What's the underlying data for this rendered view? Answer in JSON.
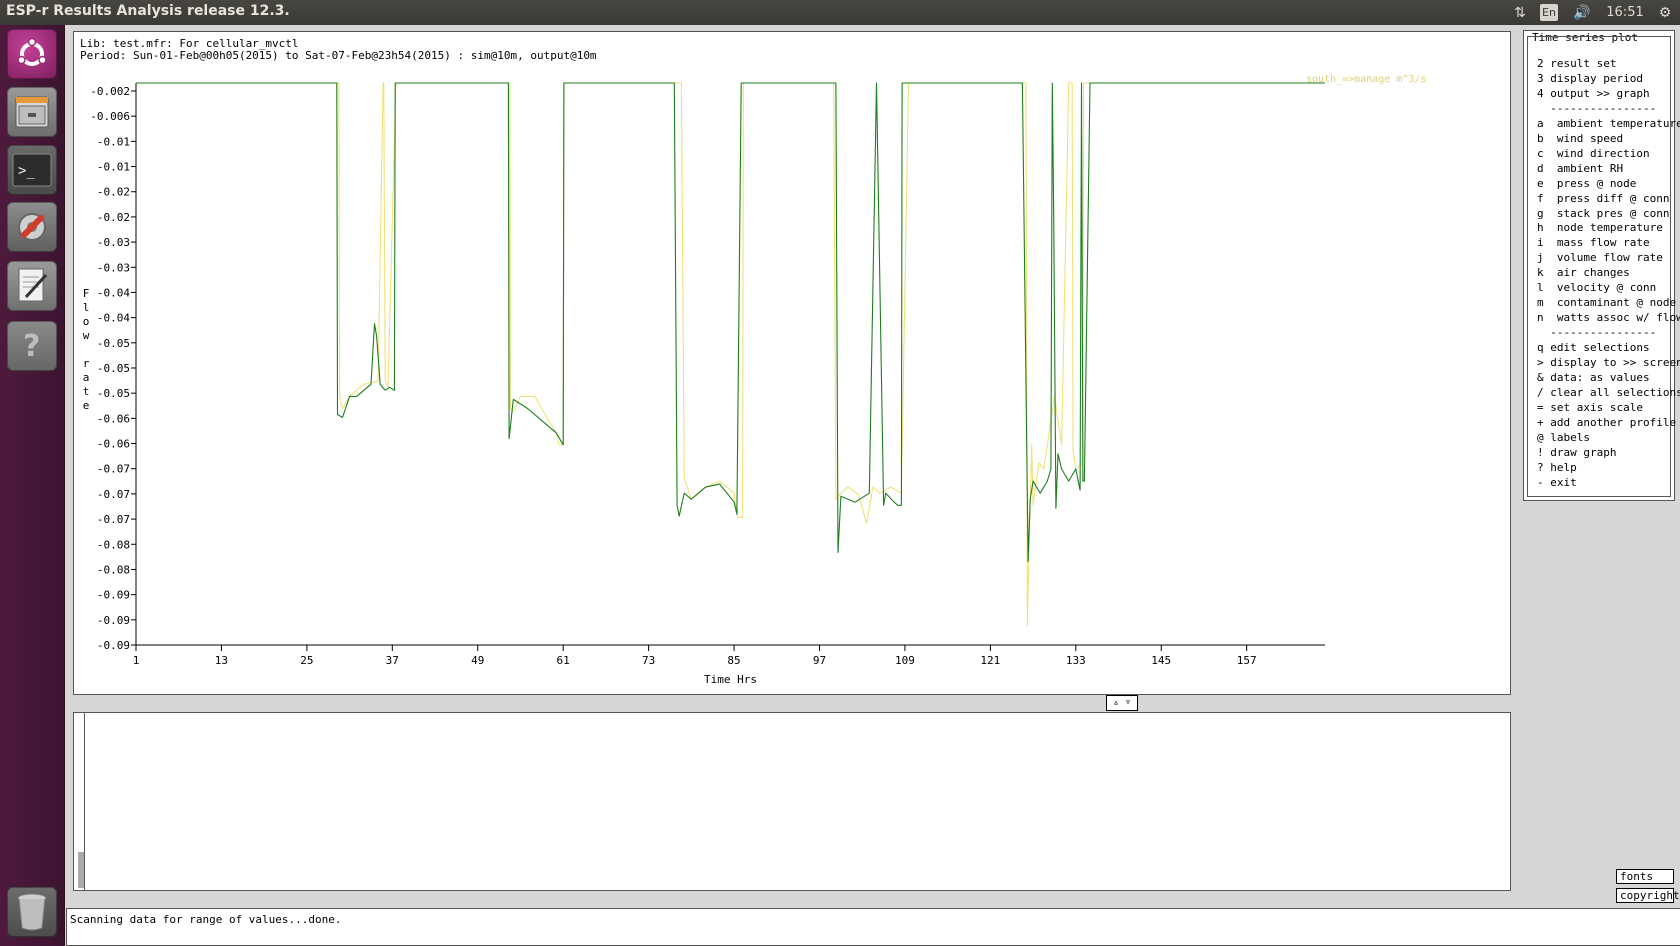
{
  "window": {
    "title": "ESP-r Results Analysis release 12.3."
  },
  "tray": {
    "lang": "En",
    "time": "16:51"
  },
  "launcher": {
    "items": [
      {
        "name": "dash-home",
        "icon": "ubuntu-logo-icon"
      },
      {
        "name": "files",
        "icon": "file-cabinet-icon"
      },
      {
        "name": "terminal",
        "icon": "terminal-icon"
      },
      {
        "name": "system-settings",
        "icon": "wrench-gear-icon"
      },
      {
        "name": "text-editor",
        "icon": "text-editor-icon"
      },
      {
        "name": "help",
        "icon": "question-icon"
      },
      {
        "name": "trash",
        "icon": "trash-icon"
      }
    ]
  },
  "graph": {
    "lib_line": "Lib: test.mfr: For cellular_mvctl",
    "period_line": "Period: Sun-01-Feb@00h05(2015) to Sat-07-Feb@23h54(2015) : sim@10m, output@10m",
    "y_label_chars": [
      "F",
      "l",
      "o",
      "w",
      "",
      "r",
      "a",
      "t",
      "e"
    ],
    "x_label": "Time Hrs",
    "legend_text": "south_=>manage m^3/s"
  },
  "chart_data": {
    "type": "line",
    "x_ticks": [
      "1",
      "13",
      "25",
      "37",
      "49",
      "61",
      "73",
      "85",
      "97",
      "109",
      "121",
      "133",
      "145",
      "157"
    ],
    "y_ticks": [
      "-0.002",
      "-0.006",
      "-0.01",
      "-0.01",
      "-0.02",
      "-0.02",
      "-0.03",
      "-0.03",
      "-0.04",
      "-0.04",
      "-0.05",
      "-0.05",
      "-0.05",
      "-0.06",
      "-0.06",
      "-0.07",
      "-0.07",
      "-0.07",
      "-0.08",
      "-0.08",
      "-0.09",
      "-0.09",
      "-0.09"
    ],
    "xlim": [
      1,
      168
    ],
    "ylim": [
      -0.0931,
      -0.0002
    ],
    "xlabel": "Time Hrs",
    "ylabel": "Flow rate",
    "legend": "top-right",
    "series": [
      {
        "name": "south_=>manage m^3/s",
        "color": "#efe27a",
        "x": [
          1,
          29.5,
          29.6,
          30,
          31,
          33,
          35,
          35.7,
          35.8,
          36,
          36.4,
          37.5,
          37.6,
          38,
          53.5,
          53.6,
          54,
          55,
          57,
          59,
          60,
          60.4,
          61,
          61.1,
          62,
          76,
          77.6,
          78,
          79,
          81,
          83,
          85,
          85.5,
          86.2,
          86.3,
          87,
          99,
          99.3,
          100,
          101,
          102.5,
          103.6,
          104.5,
          105.5,
          107,
          108.5,
          109.5,
          109.6,
          110,
          114,
          126,
          126.2,
          126.4,
          126.8,
          127,
          127.8,
          128.5,
          130,
          131,
          132,
          132.5,
          132.6,
          133,
          134,
          134.1,
          134.4,
          135,
          168
        ],
        "y": [
          -0.0002,
          -0.0002,
          -0.052,
          -0.054,
          -0.052,
          -0.05,
          -0.0495,
          -0.0002,
          -0.0002,
          -0.0495,
          -0.0505,
          -0.0002,
          -0.0002,
          -0.0002,
          -0.0002,
          -0.054,
          -0.0545,
          -0.052,
          -0.052,
          -0.056,
          -0.058,
          -0.06,
          -0.06,
          -0.0002,
          -0.0002,
          -0.0002,
          -0.0002,
          -0.0655,
          -0.069,
          -0.067,
          -0.066,
          -0.068,
          -0.072,
          -0.072,
          -0.0002,
          -0.0002,
          -0.0002,
          -0.069,
          -0.068,
          -0.067,
          -0.0683,
          -0.073,
          -0.067,
          -0.068,
          -0.067,
          -0.068,
          -0.0002,
          -0.0002,
          -0.0002,
          -0.0002,
          -0.0002,
          -0.09,
          -0.079,
          -0.06,
          -0.07,
          -0.063,
          -0.064,
          -0.052,
          -0.06,
          -0.0002,
          -0.0002,
          -0.061,
          -0.064,
          -0.063,
          -0.0002,
          -0.0002,
          -0.0002,
          -0.0002
        ]
      },
      {
        "name": "",
        "color": "#1e7d1e",
        "x": [
          1,
          29.2,
          29.3,
          30,
          31,
          32,
          34,
          34.4,
          34.5,
          34.8,
          35.3,
          36,
          36.6,
          37.3,
          37.4,
          38,
          53.3,
          53.4,
          54,
          56,
          58,
          60,
          61,
          61.1,
          62,
          76.6,
          77,
          77.3,
          78,
          79,
          81,
          83,
          85,
          85.4,
          86,
          99,
          99.3,
          99.6,
          100,
          101,
          102,
          104,
          105,
          106,
          106.3,
          107.5,
          108,
          108.5,
          108.6,
          109,
          114,
          125.5,
          126.3,
          126.6,
          127,
          128,
          129,
          129.5,
          129.7,
          129.9,
          130.2,
          130.5,
          131,
          132,
          133,
          133.6,
          133.8,
          134,
          134.2,
          135,
          168
        ],
        "y": [
          -0.0002,
          -0.0002,
          -0.055,
          -0.0555,
          -0.052,
          -0.052,
          -0.05,
          -0.042,
          -0.04,
          -0.042,
          -0.05,
          -0.051,
          -0.0505,
          -0.051,
          -0.0002,
          -0.0002,
          -0.0002,
          -0.059,
          -0.0525,
          -0.054,
          -0.056,
          -0.058,
          -0.06,
          -0.0002,
          -0.0002,
          -0.0002,
          -0.07,
          -0.0718,
          -0.068,
          -0.069,
          -0.067,
          -0.0665,
          -0.0695,
          -0.0715,
          -0.0002,
          -0.0002,
          -0.0002,
          -0.0778,
          -0.0685,
          -0.069,
          -0.0695,
          -0.068,
          -0.0002,
          -0.07,
          -0.068,
          -0.0695,
          -0.07,
          -0.07,
          -0.0002,
          -0.0002,
          -0.0002,
          -0.0002,
          -0.0793,
          -0.069,
          -0.066,
          -0.068,
          -0.066,
          -0.064,
          -0.0002,
          -0.022,
          -0.0705,
          -0.0615,
          -0.064,
          -0.066,
          -0.064,
          -0.0675,
          -0.0002,
          -0.066,
          -0.066,
          -0.0002,
          -0.0002
        ]
      }
    ]
  },
  "divider": {
    "label": "▵ ▿"
  },
  "menu": {
    "title": "Time series plot",
    "items": [
      "2 result set",
      "3 display period",
      "4 output >> graph",
      "  ----------------",
      "a  ambient temperature",
      "b  wind speed",
      "c  wind direction",
      "d  ambient RH",
      "e  press @ node",
      "f  press diff @ conn",
      "g  stack pres @ conn",
      "h  node temperature",
      "i  mass flow rate",
      "j  volume flow rate",
      "k  air changes",
      "l  velocity @ conn",
      "m  contaminant @ node",
      "n  watts assoc w/ flow",
      "  ----------------",
      "q edit selections",
      "> display to >> screen",
      "& data: as values",
      "/ clear all selections",
      "= set axis scale",
      "+ add another profile",
      "@ labels",
      "! draw graph",
      "? help",
      "- exit"
    ]
  },
  "buttons": {
    "fonts": "fonts",
    "copyright": "copyright"
  },
  "status": {
    "text": "Scanning data for range of values...done."
  }
}
